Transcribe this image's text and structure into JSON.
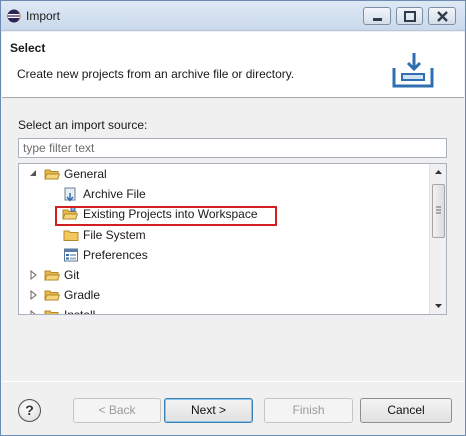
{
  "window": {
    "title": "Import"
  },
  "header": {
    "title": "Select",
    "description": "Create new projects from an archive file or directory."
  },
  "source": {
    "label": "Select an import source:",
    "filter_placeholder": "type filter text"
  },
  "tree": {
    "items": [
      {
        "label": "General",
        "expanded": true,
        "icon": "folder-open-icon"
      },
      {
        "label": "Archive File",
        "icon": "archive-file-icon"
      },
      {
        "label": "Existing Projects into Workspace",
        "icon": "existing-projects-icon",
        "selected": true
      },
      {
        "label": "File System",
        "icon": "folder-icon"
      },
      {
        "label": "Preferences",
        "icon": "preferences-icon"
      },
      {
        "label": "Git",
        "expanded": false,
        "icon": "folder-icon"
      },
      {
        "label": "Gradle",
        "expanded": false,
        "icon": "folder-icon"
      },
      {
        "label": "Install",
        "expanded": false,
        "icon": "folder-icon"
      }
    ]
  },
  "buttons": {
    "help": "?",
    "back": "< Back",
    "next": "Next >",
    "finish": "Finish",
    "cancel": "Cancel"
  },
  "colors": {
    "selection_outline": "#d21f1f",
    "folder": "#e6b74a"
  }
}
